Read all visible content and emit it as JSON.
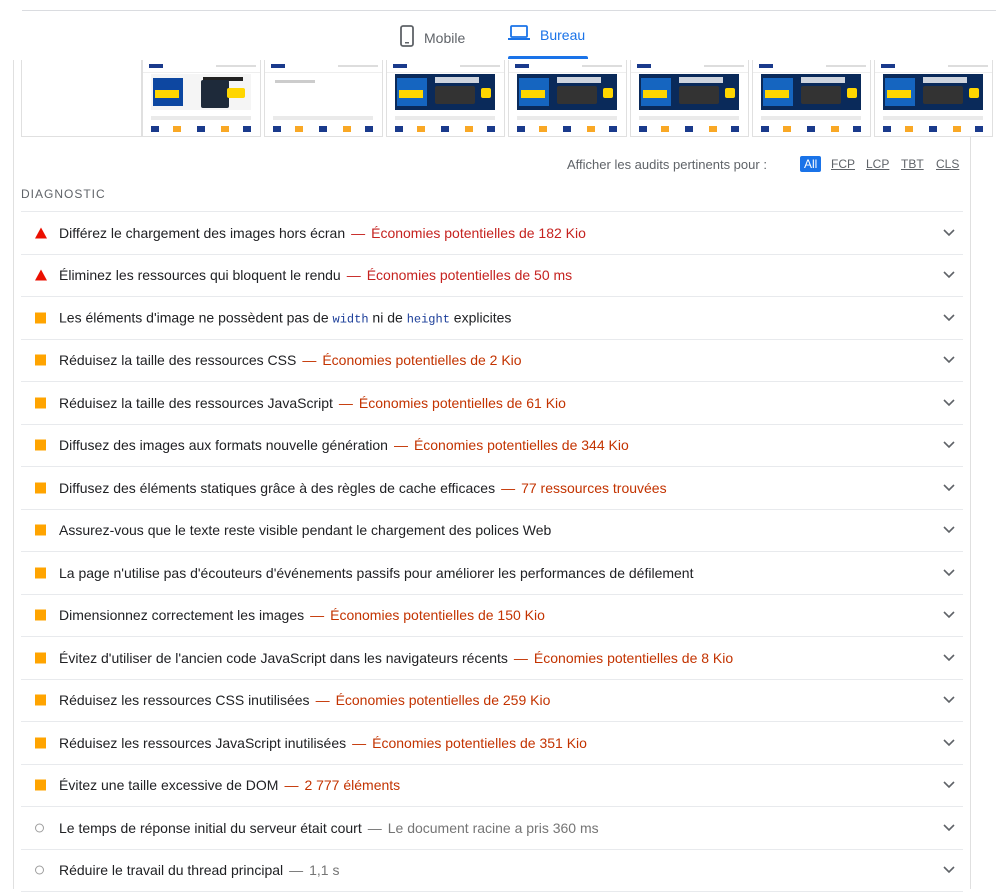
{
  "device_tabs": {
    "mobile": {
      "label": "Mobile",
      "icon": "smartphone-icon"
    },
    "desktop": {
      "label": "Bureau",
      "icon": "laptop-icon",
      "active": true
    }
  },
  "filmstrip": {
    "frames": [
      {
        "kind": "solar",
        "banner_title": "PANNEAU SOLAIRE BISOL 420W",
        "promo": "PROFITEZ DE -10%",
        "price_old": "156,64 €",
        "price": "141,16 €"
      },
      {
        "kind": "blank"
      },
      {
        "kind": "promo",
        "banner_title": "GAMME BATTERIES LITHIUM ADAPTABLES",
        "promo": "PROMOS JUSQU'À -21%"
      },
      {
        "kind": "promo",
        "banner_title": "GAMME BATTERIES LITHIUM ADAPTABLES",
        "promo": "PROMOS JUSQU'À -21%"
      },
      {
        "kind": "promo",
        "banner_title": "GAMME BATTERIES LITHIUM ADAPTABLES",
        "promo": "PROMOS JUSQU'À -21%"
      },
      {
        "kind": "promo",
        "banner_title": "GAMME BATTERIES LITHIUM ADAPTABLES",
        "promo": "PROMOS JUSQU'À -21%"
      },
      {
        "kind": "promo",
        "banner_title": "GAMME BATTERIES LITHIUM ADAPTABLES",
        "promo": "PROMOS JUSQU'À -21%"
      }
    ]
  },
  "filter": {
    "label": "Afficher les audits pertinents pour :",
    "options": [
      "All",
      "FCP",
      "LCP",
      "TBT",
      "CLS"
    ],
    "active": "All"
  },
  "section_title": "DIAGNOSTIC",
  "audits": [
    {
      "severity": "fail",
      "title": "Différez le chargement des images hors écran",
      "detail": "Économies potentielles de 182 Kio",
      "tone": "red"
    },
    {
      "severity": "fail",
      "title": "Éliminez les ressources qui bloquent le rendu",
      "detail": "Économies potentielles de 50 ms",
      "tone": "red"
    },
    {
      "severity": "average",
      "title_parts": [
        "Les éléments d'image ne possèdent pas de ",
        "width",
        " ni de ",
        "height",
        " explicites"
      ],
      "detail": "",
      "tone": "orange"
    },
    {
      "severity": "average",
      "title": "Réduisez la taille des ressources CSS",
      "detail": "Économies potentielles de 2 Kio",
      "tone": "orange"
    },
    {
      "severity": "average",
      "title": "Réduisez la taille des ressources JavaScript",
      "detail": "Économies potentielles de 61 Kio",
      "tone": "orange"
    },
    {
      "severity": "average",
      "title": "Diffusez des images aux formats nouvelle génération",
      "detail": "Économies potentielles de 344 Kio",
      "tone": "orange"
    },
    {
      "severity": "average",
      "title": "Diffusez des éléments statiques grâce à des règles de cache efficaces",
      "detail": "77 ressources trouvées",
      "tone": "orange"
    },
    {
      "severity": "average",
      "title": "Assurez-vous que le texte reste visible pendant le chargement des polices Web",
      "detail": "",
      "tone": "orange"
    },
    {
      "severity": "average",
      "title": "La page n'utilise pas d'écouteurs d'événements passifs pour améliorer les performances de défilement",
      "detail": "",
      "tone": "orange"
    },
    {
      "severity": "average",
      "title": "Dimensionnez correctement les images",
      "detail": "Économies potentielles de 150 Kio",
      "tone": "orange"
    },
    {
      "severity": "average",
      "title": "Évitez d'utiliser de l'ancien code JavaScript dans les navigateurs récents",
      "detail": "Économies potentielles de 8 Kio",
      "tone": "orange"
    },
    {
      "severity": "average",
      "title": "Réduisez les ressources CSS inutilisées",
      "detail": "Économies potentielles de 259 Kio",
      "tone": "orange"
    },
    {
      "severity": "average",
      "title": "Réduisez les ressources JavaScript inutilisées",
      "detail": "Économies potentielles de 351 Kio",
      "tone": "orange"
    },
    {
      "severity": "average",
      "title": "Évitez une taille excessive de DOM",
      "detail": "2 777 éléments",
      "tone": "orange"
    },
    {
      "severity": "info",
      "title": "Le temps de réponse initial du serveur était court",
      "detail": "Le document racine a pris 360 ms",
      "tone": "grey"
    },
    {
      "severity": "info",
      "title": "Réduire le travail du thread principal",
      "detail": "1,1 s",
      "tone": "grey"
    }
  ],
  "separator": "—",
  "colors": {
    "fail": "#eb0f00",
    "average": "#ffa400",
    "info": "#9e9e9e",
    "accent": "#1a73e8"
  }
}
